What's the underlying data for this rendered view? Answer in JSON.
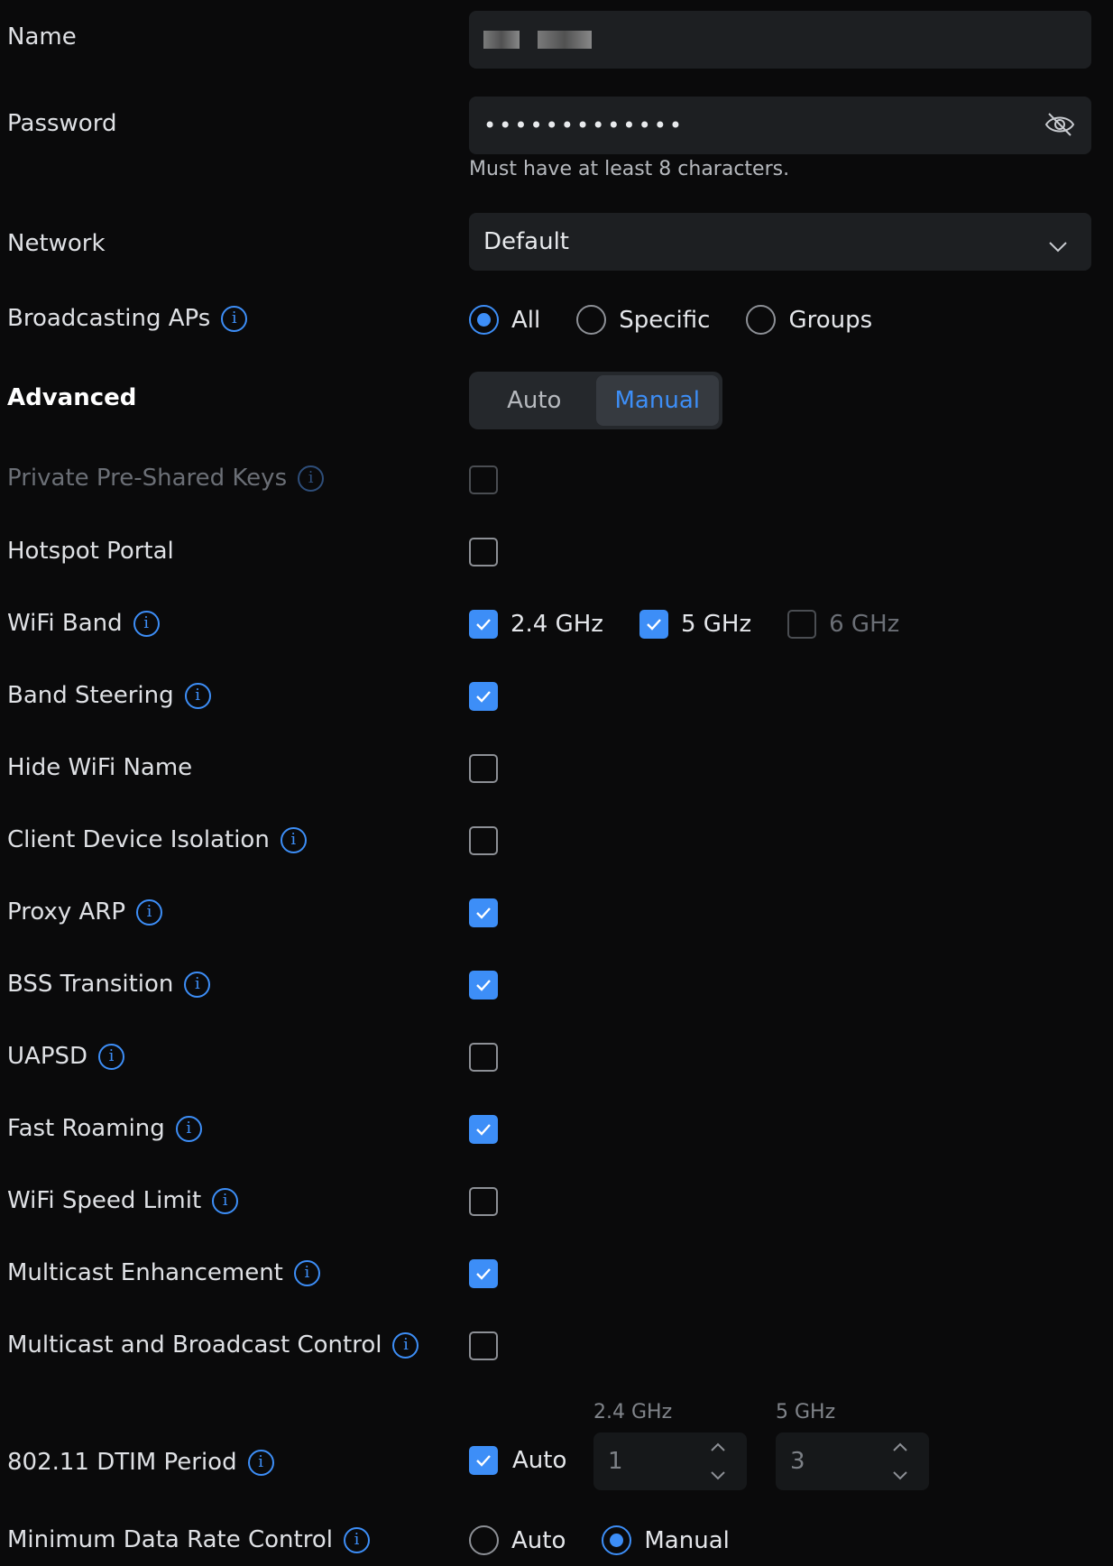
{
  "name": {
    "label": "Name"
  },
  "password": {
    "label": "Password",
    "value": "•••••••••••••",
    "hint": "Must have at least 8 characters."
  },
  "network": {
    "label": "Network",
    "value": "Default"
  },
  "broadcasting_aps": {
    "label": "Broadcasting APs",
    "options": [
      "All",
      "Specific",
      "Groups"
    ],
    "selected": "All"
  },
  "advanced": {
    "label": "Advanced",
    "options": [
      "Auto",
      "Manual"
    ],
    "selected": "Manual"
  },
  "settings": {
    "ppsk": {
      "label": "Private Pre-Shared Keys",
      "checked": false,
      "disabled": true
    },
    "hotspot": {
      "label": "Hotspot Portal",
      "checked": false
    },
    "wifi_band": {
      "label": "WiFi Band",
      "b24": "2.4 GHz",
      "b5": "5 GHz",
      "b6": "6 GHz"
    },
    "band_steering": {
      "label": "Band Steering",
      "checked": true
    },
    "hide_name": {
      "label": "Hide WiFi Name",
      "checked": false
    },
    "isolation": {
      "label": "Client Device Isolation",
      "checked": false
    },
    "proxy_arp": {
      "label": "Proxy ARP",
      "checked": true
    },
    "bss": {
      "label": "BSS Transition",
      "checked": true
    },
    "uapsd": {
      "label": "UAPSD",
      "checked": false
    },
    "fast_roaming": {
      "label": "Fast Roaming",
      "checked": true
    },
    "speed_limit": {
      "label": "WiFi Speed Limit",
      "checked": false
    },
    "multicast_enh": {
      "label": "Multicast Enhancement",
      "checked": true
    },
    "mcast_bcast": {
      "label": "Multicast and Broadcast Control",
      "checked": false
    }
  },
  "dtim": {
    "label": "802.11 DTIM Period",
    "auto_label": "Auto",
    "cap_24": "2.4 GHz",
    "cap_5": "5 GHz",
    "val_24": "1",
    "val_5": "3"
  },
  "min_rate": {
    "label": "Minimum Data Rate Control",
    "auto": "Auto",
    "manual": "Manual",
    "selected": "Manual"
  },
  "colors": {
    "accent": "#3d8ef7",
    "background": "#0a0a0b",
    "field": "#1d1f22"
  }
}
